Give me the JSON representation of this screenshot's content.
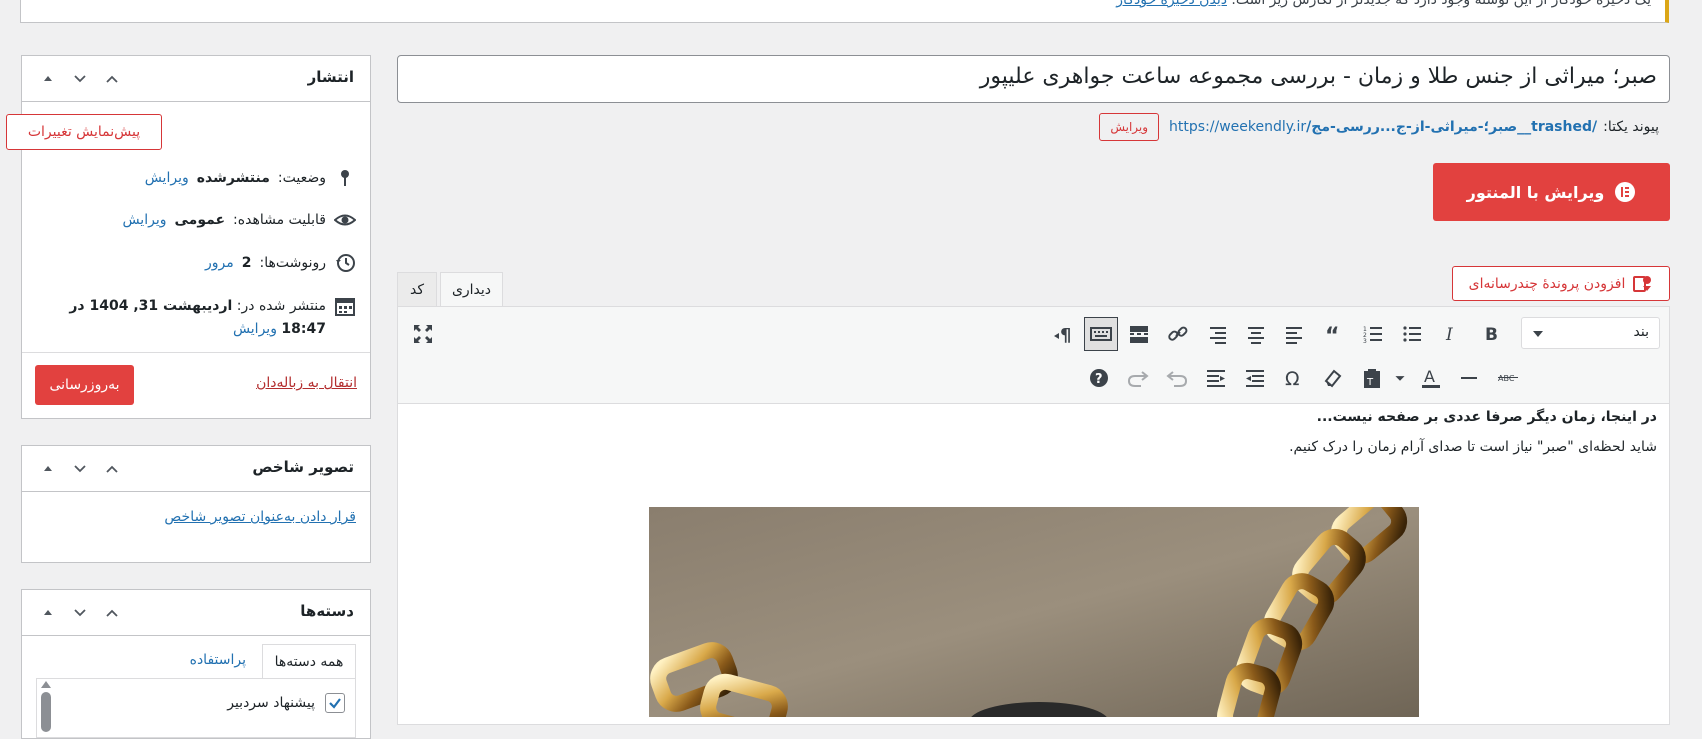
{
  "notice": {
    "text": "یک ذخیرهٔ خودکار از این نوشته وجود دارد که جدیدتر از نگارش زیر است.",
    "link": "دیدن ذخیرهٔ خودکار"
  },
  "publish_box": {
    "title": "انتشار",
    "preview_button": "پیش‌نمایش تغییرات",
    "status_label": "وضعیت:",
    "status_value": "منتشرشده",
    "status_edit": "ویرایش",
    "visibility_label": "قابلیت مشاهده:",
    "visibility_value": "عمومی",
    "visibility_edit": "ویرایش",
    "revisions_label": "رونوشت‌ها:",
    "revisions_value": "2",
    "revisions_link": "مرور",
    "published_label": "منتشر شده در:",
    "published_date": "اردیبهشت 31, 1404 در",
    "published_time": "18:47",
    "published_edit": "ویرایش",
    "trash_link": "انتقال به زباله‌دان",
    "update_button": "به‌روزرسانی"
  },
  "featured_box": {
    "title": "تصویر شاخص",
    "set_link": "قرار دادن به‌عنوان تصویر شاخص"
  },
  "categories_box": {
    "title": "دسته‌ها",
    "tab_all": "همه دسته‌ها",
    "tab_popular": "پراستفاده",
    "items": [
      {
        "label": "پیشنهاد سردبیر",
        "checked": true
      }
    ]
  },
  "post": {
    "title": "صبر؛ میراثی از جنس طلا و زمان - بررسی مجموعه ساعت جواهری علیپور",
    "permalink_label": "پیوند یکتا:",
    "permalink_base": "https://weekendly.ir",
    "permalink_slug": "/صبر؛-میراثی-از-ج...ررسی-مج__trashed/",
    "permalink_edit": "ویرایش"
  },
  "elementor_button": "ویرایش با المنتور",
  "add_media_button": "افزودن پروندهٔ چندرسانه‌ای",
  "editor_tabs": {
    "visual": "دیداری",
    "code": "کد"
  },
  "format_select": {
    "value": "بند",
    "options": [
      "بند"
    ]
  },
  "content": {
    "line1": "در اینجا، زمان دیگر صرفا عددی بر صفحه نیست...",
    "line2": "شاید لحظه‌ای \"صبر\" نیاز است تا صدای آرام زمان را درک کنیم."
  },
  "toolbar_row1": [
    "bold-icon",
    "italic-icon",
    "bullet-list-icon",
    "numbered-list-icon",
    "blockquote-icon",
    "align-right-icon",
    "align-center-icon",
    "align-left-icon",
    "link-icon",
    "read-more-icon",
    "toolbar-toggle-icon",
    "rtl-direction-icon"
  ],
  "toolbar_row2": [
    "strikethrough-icon",
    "horizontal-line-icon",
    "text-color-icon",
    "paste-text-icon",
    "clear-formatting-icon",
    "special-char-icon",
    "indent-icon",
    "outdent-icon",
    "undo-icon",
    "redo-icon",
    "help-icon"
  ],
  "colors": {
    "accent": "#2271b1",
    "danger": "#d63638",
    "elementor": "#e2413f"
  }
}
